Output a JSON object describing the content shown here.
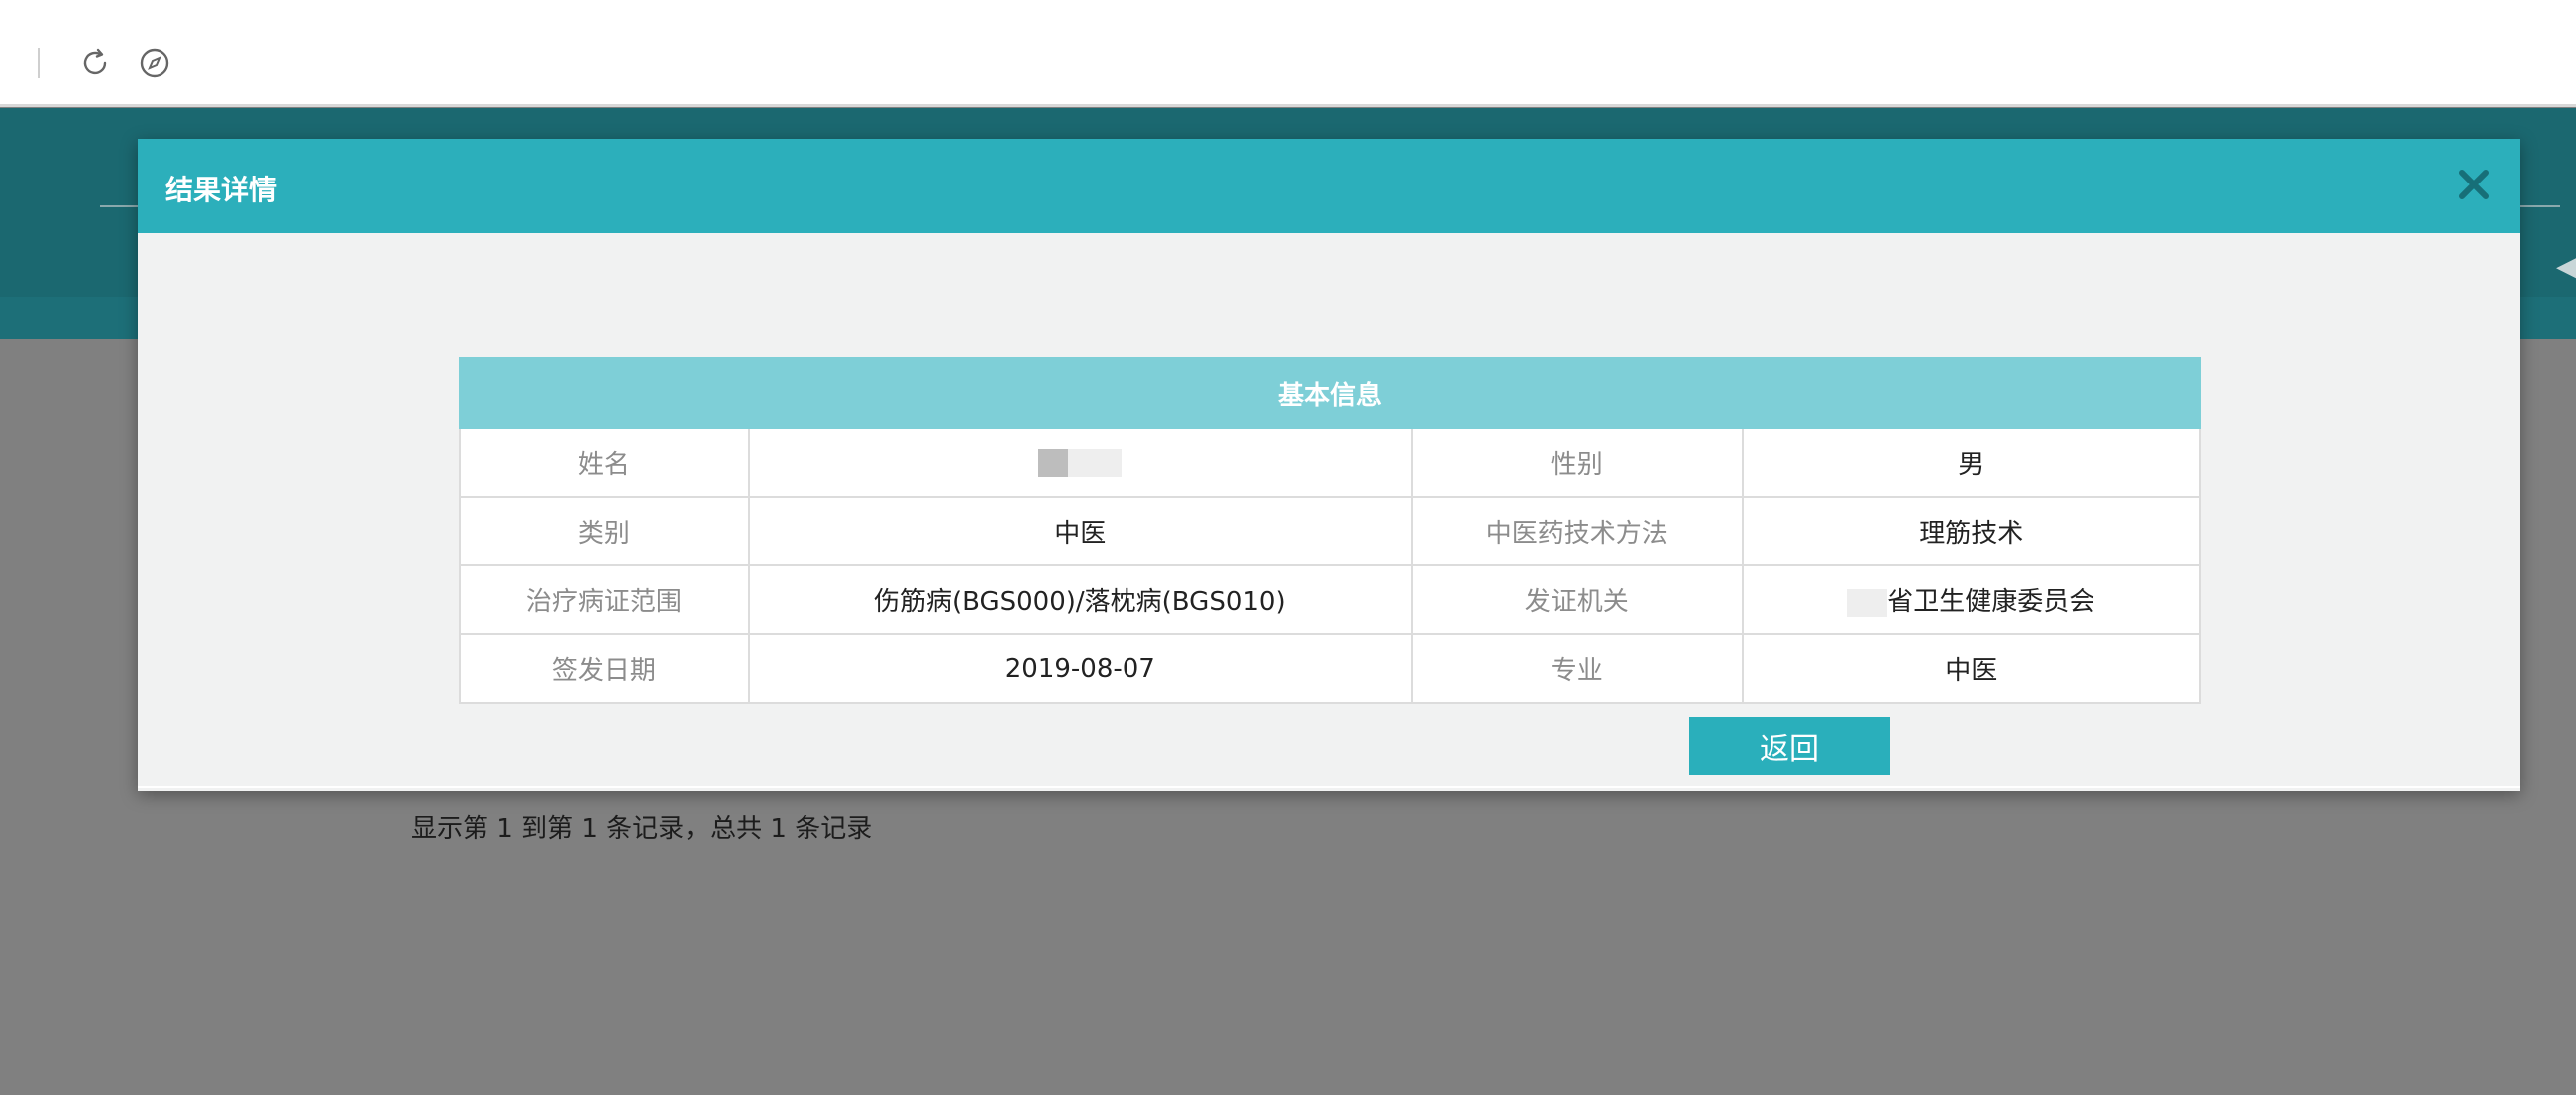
{
  "toolbar": {
    "icons": [
      "refresh-icon",
      "compass-icon"
    ]
  },
  "modal": {
    "title": "结果详情",
    "close_icon": "close-icon",
    "section_title": "基本信息",
    "rows": [
      {
        "label1": "姓名",
        "value1": "",
        "label2": "性别",
        "value2": "男"
      },
      {
        "label1": "类别",
        "value1": "中医",
        "label2": "中医药技术方法",
        "value2": "理筋技术"
      },
      {
        "label1": "治疗病证范围",
        "value1": "伤筋病(BGS000)/落枕病(BGS010)",
        "label2": "发证机关",
        "value2": "省卫生健康委员会"
      },
      {
        "label1": "签发日期",
        "value1": "2019-08-07",
        "label2": "专业",
        "value2": "中医"
      }
    ],
    "return_label": "返回"
  },
  "footer": {
    "record_text": "显示第 1 到第 1 条记录，总共 1 条记录"
  },
  "colors": {
    "modal_header": "#2cafbb",
    "section_header": "#7ecfd7",
    "button": "#2aafbb",
    "overlay": "#808080",
    "page_header": "#1b6870"
  }
}
